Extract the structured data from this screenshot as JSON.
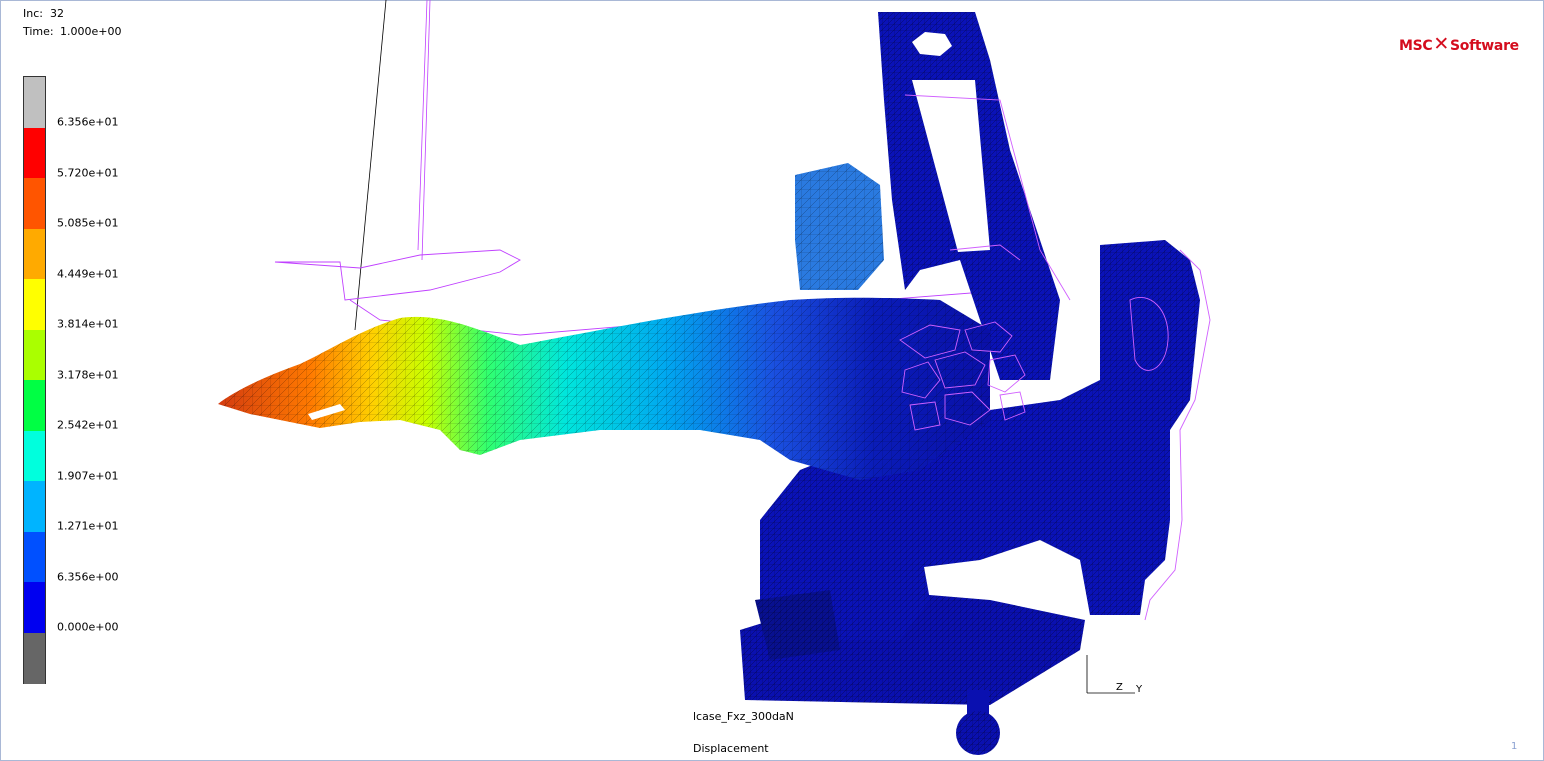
{
  "header": {
    "inc_label": "Inc:",
    "inc_value": "32",
    "time_label": "Time:",
    "time_value": "1.000e+00"
  },
  "legend": {
    "labels": [
      "6.356e+01",
      "5.720e+01",
      "5.085e+01",
      "4.449e+01",
      "3.814e+01",
      "3.178e+01",
      "2.542e+01",
      "1.907e+01",
      "1.271e+01",
      "6.356e+00",
      "0.000e+00"
    ],
    "colors": [
      "#c0c0c0",
      "#ff0000",
      "#ff5500",
      "#ffaa00",
      "#ffff00",
      "#aaff00",
      "#00ff44",
      "#00ffdd",
      "#00b4ff",
      "#0050ff",
      "#0000f0",
      "#666666"
    ]
  },
  "logo": {
    "left": "MSC",
    "right": "Software",
    "color": "#d40d1e"
  },
  "footer": {
    "case_name": "lcase_Fxz_300daN",
    "result_name": "Displacement",
    "page_number": "1"
  },
  "axes": {
    "z": "Z",
    "y": "Y"
  }
}
